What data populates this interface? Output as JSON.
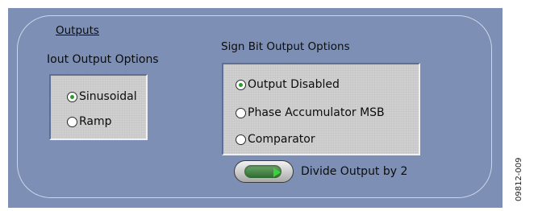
{
  "outputs": {
    "title": "Outputs",
    "iout": {
      "label": "Iout Output Options",
      "options": [
        {
          "label": "Sinusoidal",
          "selected": true
        },
        {
          "label": "Ramp",
          "selected": false
        }
      ]
    },
    "sign_bit": {
      "label": "Sign Bit Output Options",
      "options": [
        {
          "label": "Output Disabled",
          "selected": true
        },
        {
          "label": "Phase Accumulator MSB",
          "selected": false
        },
        {
          "label": "Comparator",
          "selected": false
        }
      ]
    },
    "divide_toggle": {
      "label": "Divide Output by 2",
      "on": true
    }
  },
  "figure_id": "09812-009",
  "colors": {
    "panel": "#7d8fb5",
    "group_bg": "#d0d0d0",
    "radio_dot": "#2e9a2e",
    "led": "#3ad13a"
  }
}
